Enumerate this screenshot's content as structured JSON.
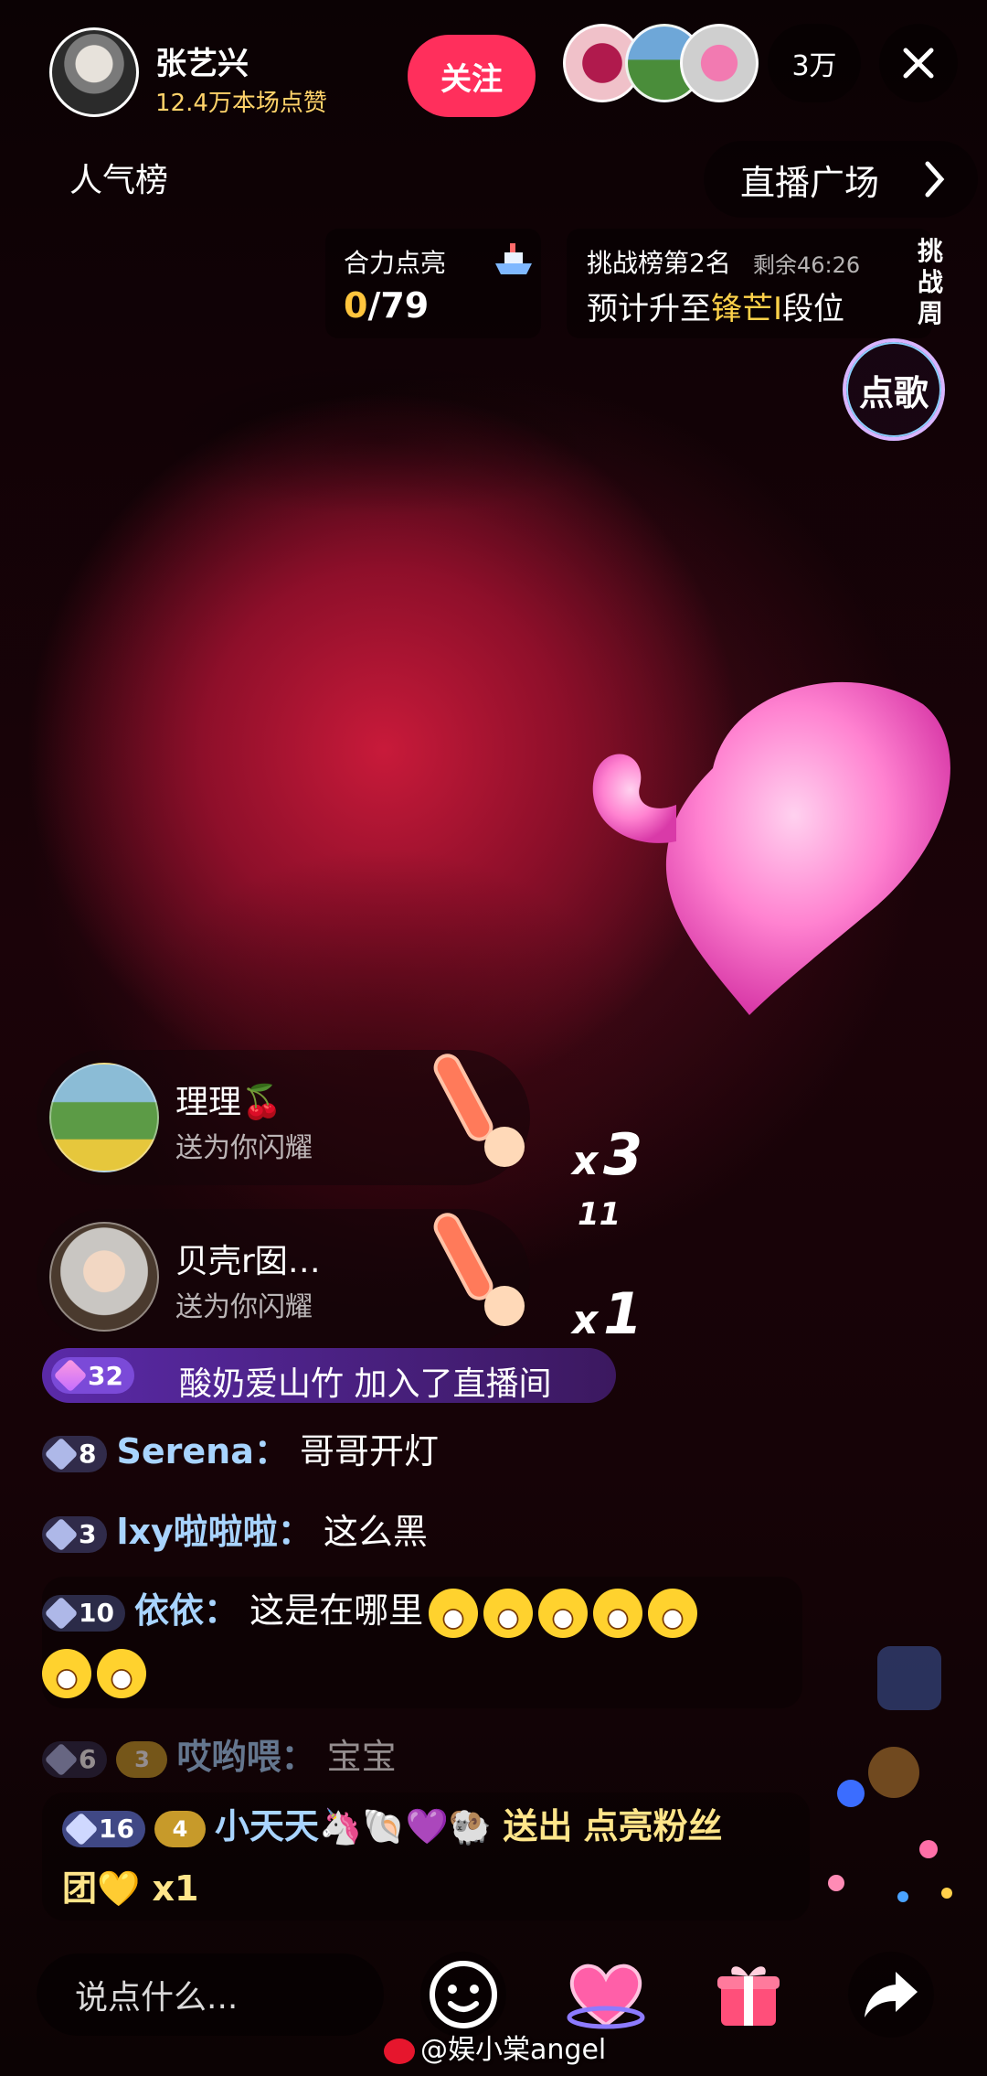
{
  "host": {
    "name": "张艺兴",
    "likes": "12.4万本场点赞",
    "follow_label": "关注"
  },
  "viewers": {
    "count": "3万"
  },
  "nav": {
    "popular_label": "人气榜",
    "plaza_label": "直播广场"
  },
  "light_up": {
    "title": "合力点亮",
    "current": "0",
    "total": "/79"
  },
  "challenge": {
    "title": "挑战榜第2名",
    "remaining": "剩余46:26",
    "sub_prefix": "预计升至",
    "sub_highlight": "锋芒I",
    "sub_suffix": "段位",
    "week_label": [
      "挑",
      "战",
      "周"
    ]
  },
  "song_button": "点歌",
  "gifts": [
    {
      "name": "理理🍒",
      "action": "送为你闪耀",
      "x": "x",
      "count": "3",
      "combo": "11"
    },
    {
      "name": "贝壳r囡…",
      "action": "送为你闪耀",
      "x": "x",
      "count": "1"
    }
  ],
  "join": {
    "level": "32",
    "text": "酸奶爱山竹 加入了直播间"
  },
  "comments": [
    {
      "level": "8",
      "user": "Serena",
      "sep": "：",
      "text": "哥哥开灯"
    },
    {
      "level": "3",
      "user": "lxy啦啦啦",
      "sep": "：",
      "text": "这么黑"
    },
    {
      "level": "10",
      "user": "依依",
      "sep": "：",
      "text": "这是在哪里"
    },
    {
      "level": "6",
      "fan_level": "3",
      "user": "哎哟喂",
      "sep": "：",
      "text": "宝宝"
    }
  ],
  "gift_message": {
    "level": "16",
    "fan_level": "4",
    "user": "小天天🦄🐚💜🐏",
    "action": "送出",
    "gift": "点亮粉丝",
    "line2": "团💛 x1"
  },
  "input": {
    "placeholder": "说点什么..."
  },
  "watermark": "@娱小棠angel",
  "colors": {
    "follow": "#ff2f5c",
    "accent_gold": "#ffc53d",
    "username_blue": "#a8d4ff"
  }
}
